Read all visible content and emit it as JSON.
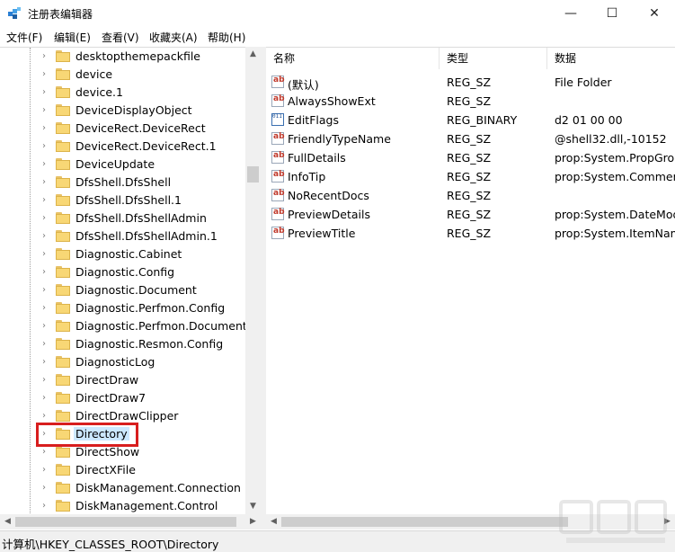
{
  "window": {
    "title": "注册表编辑器",
    "controls": {
      "minimize": "—",
      "maximize": "☐",
      "close": "✕"
    }
  },
  "menu": [
    "文件(F)",
    "编辑(E)",
    "查看(V)",
    "收藏夹(A)",
    "帮助(H)"
  ],
  "tree": {
    "items": [
      "desktopthemepackfile",
      "device",
      "device.1",
      "DeviceDisplayObject",
      "DeviceRect.DeviceRect",
      "DeviceRect.DeviceRect.1",
      "DeviceUpdate",
      "DfsShell.DfsShell",
      "DfsShell.DfsShell.1",
      "DfsShell.DfsShellAdmin",
      "DfsShell.DfsShellAdmin.1",
      "Diagnostic.Cabinet",
      "Diagnostic.Config",
      "Diagnostic.Document",
      "Diagnostic.Perfmon.Config",
      "Diagnostic.Perfmon.Document",
      "Diagnostic.Resmon.Config",
      "DiagnosticLog",
      "DirectDraw",
      "DirectDraw7",
      "DirectDrawClipper",
      "Directory",
      "DirectShow",
      "DirectXFile",
      "DiskManagement.Connection",
      "DiskManagement.Control"
    ],
    "selected": "Directory"
  },
  "list": {
    "columns": {
      "name": "名称",
      "type": "类型",
      "data": "数据"
    },
    "rows": [
      {
        "name": "(默认)",
        "type": "REG_SZ",
        "data": "File Folder",
        "icon": "string-value-icon"
      },
      {
        "name": "AlwaysShowExt",
        "type": "REG_SZ",
        "data": "",
        "icon": "string-value-icon"
      },
      {
        "name": "EditFlags",
        "type": "REG_BINARY",
        "data": "d2 01 00 00",
        "icon": "binary-value-icon"
      },
      {
        "name": "FriendlyTypeName",
        "type": "REG_SZ",
        "data": "@shell32.dll,-10152",
        "icon": "string-value-icon"
      },
      {
        "name": "FullDetails",
        "type": "REG_SZ",
        "data": "prop:System.PropGrou",
        "icon": "string-value-icon"
      },
      {
        "name": "InfoTip",
        "type": "REG_SZ",
        "data": "prop:System.Comment",
        "icon": "string-value-icon"
      },
      {
        "name": "NoRecentDocs",
        "type": "REG_SZ",
        "data": "",
        "icon": "string-value-icon"
      },
      {
        "name": "PreviewDetails",
        "type": "REG_SZ",
        "data": "prop:System.DateMod",
        "icon": "string-value-icon"
      },
      {
        "name": "PreviewTitle",
        "type": "REG_SZ",
        "data": "prop:System.ItemNam",
        "icon": "string-value-icon"
      }
    ]
  },
  "status": {
    "path": "计算机\\HKEY_CLASSES_ROOT\\Directory"
  },
  "colors": {
    "highlight_box": "#d81e1e",
    "selection": "#cce8ff",
    "folder": "#f8d775"
  }
}
